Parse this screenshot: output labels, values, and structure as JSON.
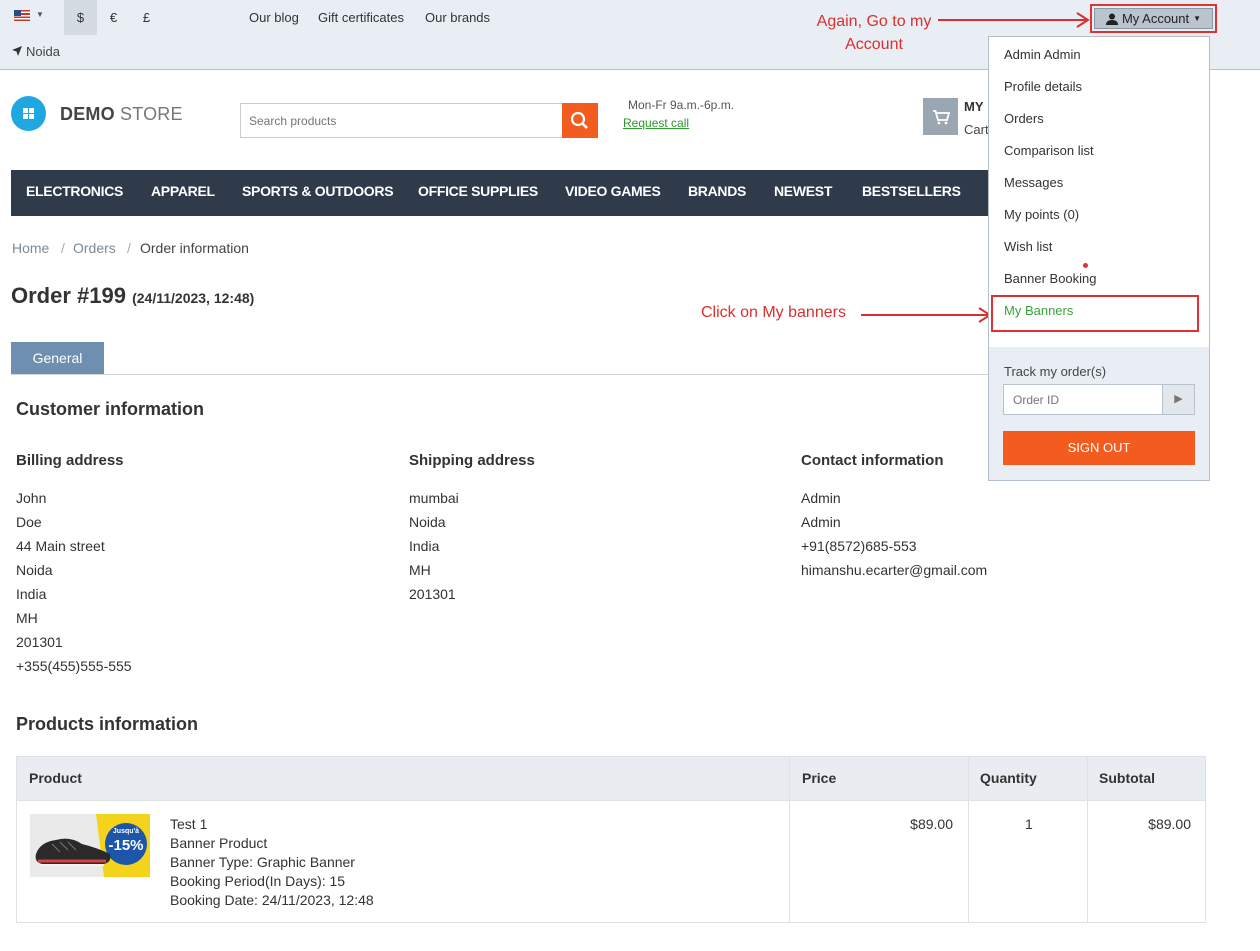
{
  "topbar": {
    "currencies": [
      "$",
      "€",
      "£"
    ],
    "links": [
      "Our blog",
      "Gift certificates",
      "Our brands"
    ],
    "location": "Noida",
    "account_button": "My Account"
  },
  "annotations": {
    "go_to_account": "Again, Go to my Account",
    "click_banners": "Click on My banners"
  },
  "header": {
    "logo_bold": "DEMO",
    "logo_light": "STORE",
    "search_placeholder": "Search products",
    "hours": "Mon-Fr 9a.m.-6p.m.",
    "request_call": "Request call",
    "cart_title": "MY",
    "cart_sub": "Cart"
  },
  "nav": [
    "ELECTRONICS",
    "APPAREL",
    "SPORTS & OUTDOORS",
    "OFFICE SUPPLIES",
    "VIDEO GAMES",
    "BRANDS",
    "NEWEST",
    "BESTSELLERS"
  ],
  "breadcrumb": [
    "Home",
    "Orders",
    "Order information"
  ],
  "order": {
    "title": "Order #199",
    "date": "(24/11/2023, 12:48)",
    "tab": "General"
  },
  "customer": {
    "heading": "Customer information",
    "billing_title": "Billing address",
    "billing": [
      "John",
      "Doe",
      "44 Main street",
      "Noida",
      "India",
      "MH",
      "201301",
      "+355(455)555-555"
    ],
    "shipping_title": "Shipping address",
    "shipping": [
      "mumbai",
      "Noida",
      "India",
      "MH",
      "201301"
    ],
    "contact_title": "Contact information",
    "contact": [
      "Admin",
      "Admin",
      "+91(8572)685-553",
      "himanshu.ecarter@gmail.com"
    ]
  },
  "products": {
    "heading": "Products information",
    "columns": [
      "Product",
      "Price",
      "Quantity",
      "Subtotal"
    ],
    "row": {
      "details": [
        "Test 1",
        "Banner Product",
        "Banner Type: Graphic Banner",
        "Booking Period(In Days): 15",
        "Booking Date: 24/11/2023, 12:48"
      ],
      "price": "$89.00",
      "quantity": "1",
      "subtotal": "$89.00",
      "badge_top": "Jusqu'à",
      "badge_main": "-15%"
    }
  },
  "dropdown": {
    "items": [
      "Admin Admin",
      "Profile details",
      "Orders",
      "Comparison list",
      "Messages",
      "My points (0)",
      "Wish list",
      "Banner Booking",
      "My Banners"
    ],
    "track_label": "Track my order(s)",
    "order_placeholder": "Order ID",
    "sign_out": "SIGN OUT"
  }
}
